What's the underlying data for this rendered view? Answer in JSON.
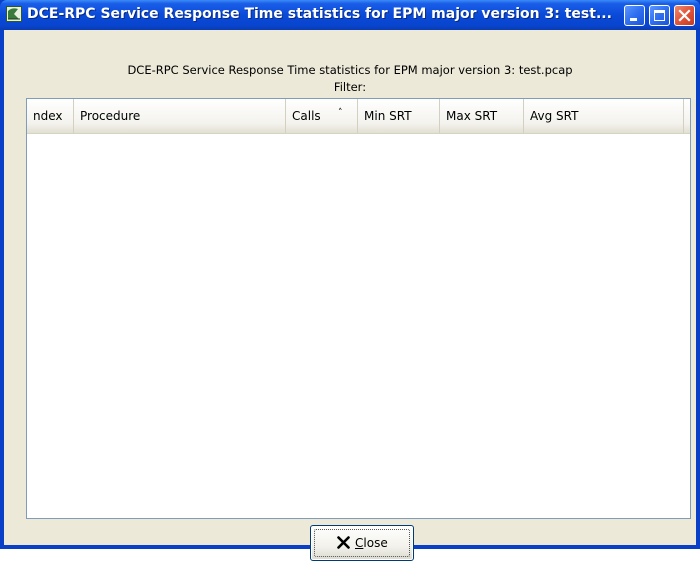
{
  "window": {
    "title": "DCE-RPC Service Response Time statistics for EPM major version 3: test...",
    "title_bar_color": "#0a4ad8",
    "close_button_color": "#e0543a",
    "title_buttons": [
      "minimize-icon",
      "maximize-icon",
      "close-icon"
    ]
  },
  "header": {
    "line1": "DCE-RPC Service Response Time statistics for EPM major version 3: test.pcap",
    "line2": "Filter:"
  },
  "table": {
    "columns": [
      {
        "label": "ndex"
      },
      {
        "label": "Procedure"
      },
      {
        "label": "Calls",
        "sort_indicator": "˄"
      },
      {
        "label": "Min SRT"
      },
      {
        "label": "Max SRT"
      },
      {
        "label": "Avg SRT"
      }
    ],
    "rows": []
  },
  "footer": {
    "close_button": {
      "mnemonic": "C",
      "label_rest": "lose",
      "icon": "x-icon"
    }
  }
}
